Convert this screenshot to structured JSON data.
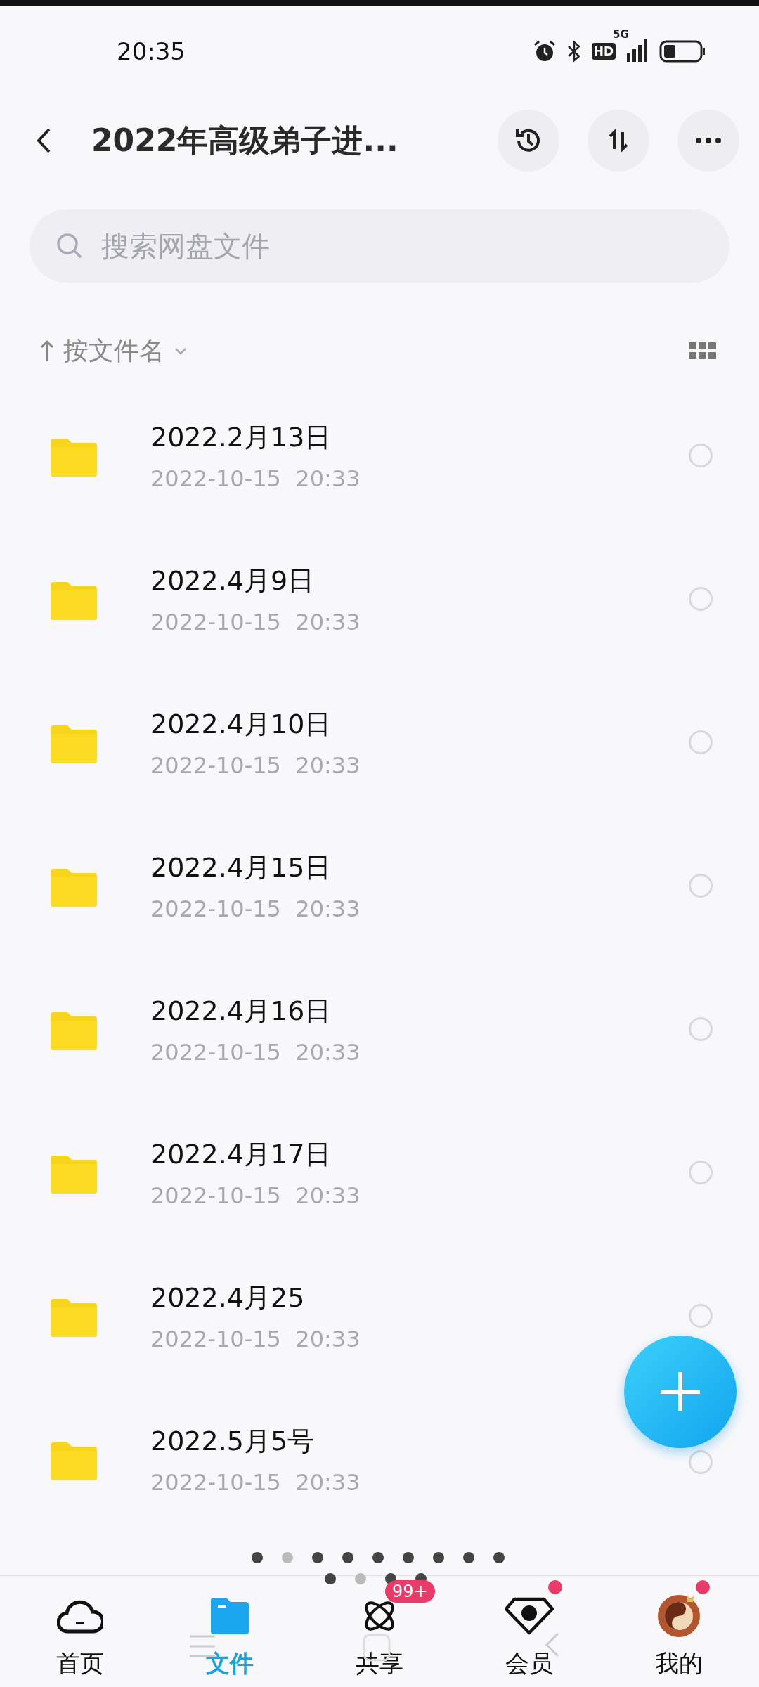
{
  "status_bar": {
    "time": "20:35",
    "hd": "HD",
    "network": "5G"
  },
  "header": {
    "title": "2022年高级弟子进..."
  },
  "search": {
    "placeholder": "搜索网盘文件"
  },
  "sort": {
    "label": "按文件名"
  },
  "files": [
    {
      "name": "2022.2月13日",
      "date": "2022-10-15  20:33",
      "checked": false
    },
    {
      "name": "2022.4月9日",
      "date": "2022-10-15  20:33",
      "checked": false
    },
    {
      "name": "2022.4月10日",
      "date": "2022-10-15  20:33",
      "checked": false
    },
    {
      "name": "2022.4月15日",
      "date": "2022-10-15  20:33",
      "checked": false
    },
    {
      "name": "2022.4月16日",
      "date": "2022-10-15  20:33",
      "checked": false
    },
    {
      "name": "2022.4月17日",
      "date": "2022-10-15  20:33",
      "checked": false
    },
    {
      "name": "2022.4月25",
      "date": "2022-10-15  20:33",
      "checked": false
    },
    {
      "name": "2022.5月5号",
      "date": "2022-10-15  20:33",
      "checked": false
    }
  ],
  "page_dots": [
    {
      "selected": false
    },
    {
      "selected": true
    },
    {
      "selected": false
    },
    {
      "selected": false
    },
    {
      "selected": false
    },
    {
      "selected": false
    },
    {
      "selected": false
    },
    {
      "selected": false
    },
    {
      "selected": false
    }
  ],
  "page_dots_2": [
    {
      "selected": false
    },
    {
      "selected": true
    },
    {
      "selected": false
    },
    {
      "selected": false
    }
  ],
  "tabs": [
    {
      "kind": "home",
      "label": "首页",
      "selected": false
    },
    {
      "kind": "files",
      "label": "文件",
      "selected": true
    },
    {
      "kind": "share",
      "label": "共享",
      "selected": false,
      "badge": "99+"
    },
    {
      "kind": "vip",
      "label": "会员",
      "selected": false,
      "dot": true
    },
    {
      "kind": "me",
      "label": "我的",
      "selected": false,
      "dot": true
    }
  ]
}
